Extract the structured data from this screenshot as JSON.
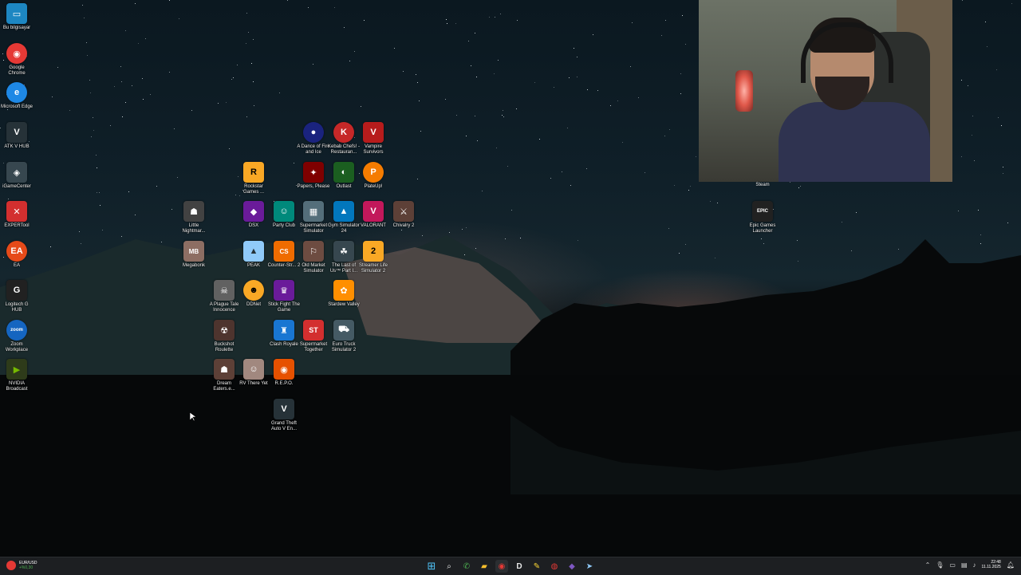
{
  "desktop": {
    "icons": [
      {
        "id": "this-pc",
        "label": "Bu bilgisayar",
        "glyph": "▭",
        "color": "#2aa9e0"
      },
      {
        "id": "chrome",
        "label": "Google Chrome",
        "glyph": "◉",
        "color": "#e53935"
      },
      {
        "id": "edge",
        "label": "Microsoft Edge",
        "glyph": "e",
        "color": "#1e88e5"
      },
      {
        "id": "atk",
        "label": "ATK V HUB",
        "glyph": "V",
        "color": "#263238"
      },
      {
        "id": "igamecenter",
        "label": "iGameCenter",
        "glyph": "◈",
        "color": "#37474f"
      },
      {
        "id": "experttool",
        "label": "EXPERTool",
        "glyph": "✕",
        "color": "#d32f2f"
      },
      {
        "id": "ea",
        "label": "EA",
        "glyph": "EA",
        "color": "#e64a19"
      },
      {
        "id": "logitech",
        "label": "Logitech G HUB",
        "glyph": "G",
        "color": "#212121"
      },
      {
        "id": "zoom",
        "label": "Zoom Workplace",
        "glyph": "zoom",
        "color": "#1565c0"
      },
      {
        "id": "nvidia",
        "label": "NVIDIA Broadcast",
        "glyph": "▶",
        "color": "#76b900"
      },
      {
        "id": "dance",
        "label": "A Dance of Fire and Ice",
        "glyph": "●",
        "color": "#3949ab"
      },
      {
        "id": "kebab",
        "label": "Kebab Chefs! - Restauran...",
        "glyph": "K",
        "color": "#c62828"
      },
      {
        "id": "vampire",
        "label": "Vampire Survivors",
        "glyph": "V",
        "color": "#b71c1c"
      },
      {
        "id": "rockstar",
        "label": "Rockstar Games ...",
        "glyph": "R",
        "color": "#f9a825"
      },
      {
        "id": "papers",
        "label": "Papers, Please",
        "glyph": "✦",
        "color": "#7f0000"
      },
      {
        "id": "outlast",
        "label": "Outlast",
        "glyph": "◐",
        "color": "#1b5e20"
      },
      {
        "id": "plateup",
        "label": "PlateUp!",
        "glyph": "P",
        "color": "#f57c00"
      },
      {
        "id": "littlenightmares",
        "label": "Little Nightmar...",
        "glyph": "☗",
        "color": "#424242"
      },
      {
        "id": "dsx",
        "label": "DSX",
        "glyph": "◆",
        "color": "#6a1b9a"
      },
      {
        "id": "partyclub",
        "label": "Party Club",
        "glyph": "☺",
        "color": "#00897b"
      },
      {
        "id": "supermarket",
        "label": "Supermarket Simulator",
        "glyph": "▦",
        "color": "#546e7a"
      },
      {
        "id": "gym",
        "label": "Gym Simulator 24",
        "glyph": "▲",
        "color": "#0277bd"
      },
      {
        "id": "valorant",
        "label": "VALORANT",
        "glyph": "V",
        "color": "#c2185b"
      },
      {
        "id": "chivalry",
        "label": "Chivalry 2",
        "glyph": "⚔",
        "color": "#5d4037"
      },
      {
        "id": "megabonk",
        "label": "Megabonk",
        "glyph": "MB",
        "color": "#8d6e63"
      },
      {
        "id": "peak",
        "label": "PEAK",
        "glyph": "▲",
        "color": "#90caf9"
      },
      {
        "id": "counterstrike",
        "label": "Counter-Str... 2",
        "glyph": "CS",
        "color": "#ef6c00"
      },
      {
        "id": "oldmarket",
        "label": "Old Market Simulator",
        "glyph": "⚐",
        "color": "#6d4c41"
      },
      {
        "id": "lastofus",
        "label": "The Last of Us™ Part I...",
        "glyph": "☘",
        "color": "#37474f"
      },
      {
        "id": "streamerlife",
        "label": "Streamer Life Simulator 2",
        "glyph": "2",
        "color": "#f9a825"
      },
      {
        "id": "plaguetale",
        "label": "A Plague Tale Innocence",
        "glyph": "☠",
        "color": "#616161"
      },
      {
        "id": "ddnet",
        "label": "DDNet",
        "glyph": "☻",
        "color": "#f9a825"
      },
      {
        "id": "stickfight",
        "label": "Stick Fight The Game",
        "glyph": "♛",
        "color": "#6a1b9a"
      },
      {
        "id": "stardew",
        "label": "Stardew Valley",
        "glyph": "✿",
        "color": "#ff8f00"
      },
      {
        "id": "buckshot",
        "label": "Buckshot Roulette",
        "glyph": "☢",
        "color": "#4e342e"
      },
      {
        "id": "clashroyale",
        "label": "Clash Royale",
        "glyph": "♜",
        "color": "#1976d2"
      },
      {
        "id": "supermarkettogether",
        "label": "Supermarket Together",
        "glyph": "ST",
        "color": "#d32f2f"
      },
      {
        "id": "eurotruck",
        "label": "Euro Truck Simulator 2",
        "glyph": "⛟",
        "color": "#455a64"
      },
      {
        "id": "dreameaters",
        "label": "Dream Eaters.e...",
        "glyph": "☗",
        "color": "#5d4037"
      },
      {
        "id": "rvthereyet",
        "label": "RV There Yet",
        "glyph": "☺",
        "color": "#a1887f"
      },
      {
        "id": "repo",
        "label": "R.E.P.O.",
        "glyph": "◉",
        "color": "#e65100"
      },
      {
        "id": "gta",
        "label": "Grand Theft Auto V En...",
        "glyph": "V",
        "color": "#263238"
      },
      {
        "id": "epic",
        "label": "Epic Games Launcher",
        "glyph": "EPIC",
        "color": "#212121"
      }
    ]
  },
  "webcam": {
    "caption": "Steam"
  },
  "taskbar": {
    "widget": {
      "pair": "EUR/USD",
      "change": "+%0,30"
    },
    "apps": [
      {
        "id": "start",
        "glyph": "⊞",
        "color": "#4fc3f7"
      },
      {
        "id": "search",
        "glyph": "⌕",
        "color": "#ffffff"
      },
      {
        "id": "whatsapp",
        "glyph": "✆",
        "color": "#4caf50"
      },
      {
        "id": "explorer",
        "glyph": "▰",
        "color": "#fbc02d"
      },
      {
        "id": "chrome",
        "glyph": "◉",
        "color": "#e53935"
      },
      {
        "id": "app-d",
        "glyph": "D",
        "color": "#ffffff"
      },
      {
        "id": "notes",
        "glyph": "✎",
        "color": "#fdd835"
      },
      {
        "id": "app-red",
        "glyph": "◍",
        "color": "#e53935"
      },
      {
        "id": "teams",
        "glyph": "◆",
        "color": "#7e57c2"
      },
      {
        "id": "steam",
        "glyph": "➤",
        "color": "#90caf9"
      }
    ],
    "tray": {
      "time": "22:48",
      "date": "11.11.2025"
    }
  }
}
